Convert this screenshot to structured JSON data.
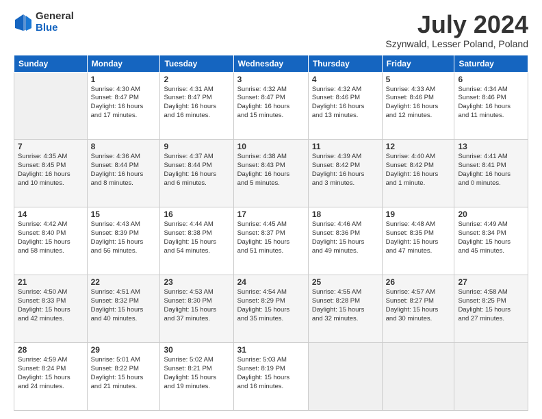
{
  "logo": {
    "general": "General",
    "blue": "Blue"
  },
  "title": "July 2024",
  "location": "Szynwald, Lesser Poland, Poland",
  "days_header": [
    "Sunday",
    "Monday",
    "Tuesday",
    "Wednesday",
    "Thursday",
    "Friday",
    "Saturday"
  ],
  "weeks": [
    [
      {
        "day": "",
        "info": ""
      },
      {
        "day": "1",
        "info": "Sunrise: 4:30 AM\nSunset: 8:47 PM\nDaylight: 16 hours\nand 17 minutes."
      },
      {
        "day": "2",
        "info": "Sunrise: 4:31 AM\nSunset: 8:47 PM\nDaylight: 16 hours\nand 16 minutes."
      },
      {
        "day": "3",
        "info": "Sunrise: 4:32 AM\nSunset: 8:47 PM\nDaylight: 16 hours\nand 15 minutes."
      },
      {
        "day": "4",
        "info": "Sunrise: 4:32 AM\nSunset: 8:46 PM\nDaylight: 16 hours\nand 13 minutes."
      },
      {
        "day": "5",
        "info": "Sunrise: 4:33 AM\nSunset: 8:46 PM\nDaylight: 16 hours\nand 12 minutes."
      },
      {
        "day": "6",
        "info": "Sunrise: 4:34 AM\nSunset: 8:46 PM\nDaylight: 16 hours\nand 11 minutes."
      }
    ],
    [
      {
        "day": "7",
        "info": "Sunrise: 4:35 AM\nSunset: 8:45 PM\nDaylight: 16 hours\nand 10 minutes."
      },
      {
        "day": "8",
        "info": "Sunrise: 4:36 AM\nSunset: 8:44 PM\nDaylight: 16 hours\nand 8 minutes."
      },
      {
        "day": "9",
        "info": "Sunrise: 4:37 AM\nSunset: 8:44 PM\nDaylight: 16 hours\nand 6 minutes."
      },
      {
        "day": "10",
        "info": "Sunrise: 4:38 AM\nSunset: 8:43 PM\nDaylight: 16 hours\nand 5 minutes."
      },
      {
        "day": "11",
        "info": "Sunrise: 4:39 AM\nSunset: 8:42 PM\nDaylight: 16 hours\nand 3 minutes."
      },
      {
        "day": "12",
        "info": "Sunrise: 4:40 AM\nSunset: 8:42 PM\nDaylight: 16 hours\nand 1 minute."
      },
      {
        "day": "13",
        "info": "Sunrise: 4:41 AM\nSunset: 8:41 PM\nDaylight: 16 hours\nand 0 minutes."
      }
    ],
    [
      {
        "day": "14",
        "info": "Sunrise: 4:42 AM\nSunset: 8:40 PM\nDaylight: 15 hours\nand 58 minutes."
      },
      {
        "day": "15",
        "info": "Sunrise: 4:43 AM\nSunset: 8:39 PM\nDaylight: 15 hours\nand 56 minutes."
      },
      {
        "day": "16",
        "info": "Sunrise: 4:44 AM\nSunset: 8:38 PM\nDaylight: 15 hours\nand 54 minutes."
      },
      {
        "day": "17",
        "info": "Sunrise: 4:45 AM\nSunset: 8:37 PM\nDaylight: 15 hours\nand 51 minutes."
      },
      {
        "day": "18",
        "info": "Sunrise: 4:46 AM\nSunset: 8:36 PM\nDaylight: 15 hours\nand 49 minutes."
      },
      {
        "day": "19",
        "info": "Sunrise: 4:48 AM\nSunset: 8:35 PM\nDaylight: 15 hours\nand 47 minutes."
      },
      {
        "day": "20",
        "info": "Sunrise: 4:49 AM\nSunset: 8:34 PM\nDaylight: 15 hours\nand 45 minutes."
      }
    ],
    [
      {
        "day": "21",
        "info": "Sunrise: 4:50 AM\nSunset: 8:33 PM\nDaylight: 15 hours\nand 42 minutes."
      },
      {
        "day": "22",
        "info": "Sunrise: 4:51 AM\nSunset: 8:32 PM\nDaylight: 15 hours\nand 40 minutes."
      },
      {
        "day": "23",
        "info": "Sunrise: 4:53 AM\nSunset: 8:30 PM\nDaylight: 15 hours\nand 37 minutes."
      },
      {
        "day": "24",
        "info": "Sunrise: 4:54 AM\nSunset: 8:29 PM\nDaylight: 15 hours\nand 35 minutes."
      },
      {
        "day": "25",
        "info": "Sunrise: 4:55 AM\nSunset: 8:28 PM\nDaylight: 15 hours\nand 32 minutes."
      },
      {
        "day": "26",
        "info": "Sunrise: 4:57 AM\nSunset: 8:27 PM\nDaylight: 15 hours\nand 30 minutes."
      },
      {
        "day": "27",
        "info": "Sunrise: 4:58 AM\nSunset: 8:25 PM\nDaylight: 15 hours\nand 27 minutes."
      }
    ],
    [
      {
        "day": "28",
        "info": "Sunrise: 4:59 AM\nSunset: 8:24 PM\nDaylight: 15 hours\nand 24 minutes."
      },
      {
        "day": "29",
        "info": "Sunrise: 5:01 AM\nSunset: 8:22 PM\nDaylight: 15 hours\nand 21 minutes."
      },
      {
        "day": "30",
        "info": "Sunrise: 5:02 AM\nSunset: 8:21 PM\nDaylight: 15 hours\nand 19 minutes."
      },
      {
        "day": "31",
        "info": "Sunrise: 5:03 AM\nSunset: 8:19 PM\nDaylight: 15 hours\nand 16 minutes."
      },
      {
        "day": "",
        "info": ""
      },
      {
        "day": "",
        "info": ""
      },
      {
        "day": "",
        "info": ""
      }
    ]
  ]
}
